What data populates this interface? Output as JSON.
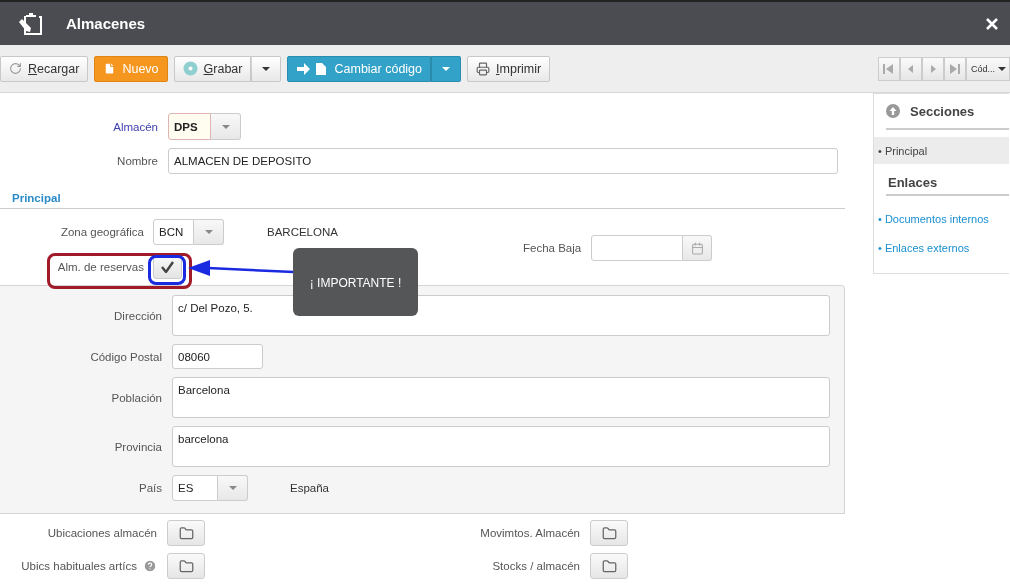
{
  "window": {
    "title": "Almacenes"
  },
  "toolbar": [
    {
      "label": "Recargar",
      "kind": "reload",
      "underline_first": true
    },
    {
      "label": "Nuevo",
      "kind": "new",
      "underline_first": false
    },
    {
      "label": "Grabar",
      "kind": "save",
      "underline_first": true
    },
    {
      "label": "Cambiar código",
      "kind": "change",
      "underline_first": false
    },
    {
      "label": "Imprimir",
      "kind": "print",
      "underline_first": true
    }
  ],
  "navigator": {
    "sort": "Cód..."
  },
  "header_fields": {
    "almacen": {
      "label": "Almacén",
      "value": "DPS"
    },
    "nombre": {
      "label": "Nombre",
      "value": "ALMACEN DE DEPOSITO"
    }
  },
  "section_title": "Principal",
  "zona": {
    "label": "Zona geográfica",
    "value": "BCN",
    "description": "BARCELONA"
  },
  "fecha_baja": {
    "label": "Fecha Baja"
  },
  "reservas": {
    "label": "Alm. de reservas",
    "checked": true
  },
  "address": [
    {
      "label": "Dirección",
      "value": "c/ Del Pozo, 5.",
      "kind": "textarea"
    },
    {
      "label": "Código Postal",
      "value": "08060",
      "kind": "short"
    },
    {
      "label": "Población",
      "value": "Barcelona",
      "kind": "textarea"
    },
    {
      "label": "Provincia",
      "value": "barcelona",
      "kind": "textarea"
    },
    {
      "label": "País",
      "value": "ES",
      "kind": "combo",
      "description": "España"
    }
  ],
  "links": [
    {
      "left": {
        "label": "Ubicaciones almacén",
        "help": false
      },
      "right": {
        "label": "Movimtos. Almacén"
      }
    },
    {
      "left": {
        "label": "Ubics habituales artícs",
        "help": true
      },
      "right": {
        "label": "Stocks / almacén"
      }
    }
  ],
  "sidebar": {
    "sections_title": "Secciones",
    "sections": [
      {
        "label": "• Principal",
        "selected": true
      }
    ],
    "links_title": "Enlaces",
    "links": [
      "• Documentos internos",
      "• Enlaces externos"
    ]
  },
  "annotation": {
    "callout": "¡ IMPORTANTE !"
  }
}
